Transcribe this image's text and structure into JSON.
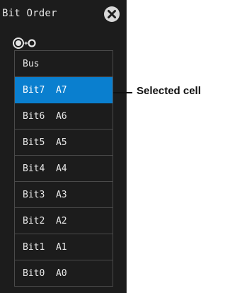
{
  "dialog": {
    "title": "Bit Order",
    "close_icon": "close-icon",
    "jog_icon": "jog-knob-icon"
  },
  "list": {
    "items": [
      {
        "label": "Bus"
      },
      {
        "label": "Bit7  A7",
        "selected": true
      },
      {
        "label": "Bit6  A6"
      },
      {
        "label": "Bit5  A5"
      },
      {
        "label": "Bit4  A4"
      },
      {
        "label": "Bit3  A3"
      },
      {
        "label": "Bit2  A2"
      },
      {
        "label": "Bit1  A1"
      },
      {
        "label": "Bit0  A0"
      }
    ]
  },
  "callout": {
    "label": "Selected cell"
  },
  "colors": {
    "panel_bg": "#1c1c1c",
    "selected_bg": "#0a7fcf"
  }
}
